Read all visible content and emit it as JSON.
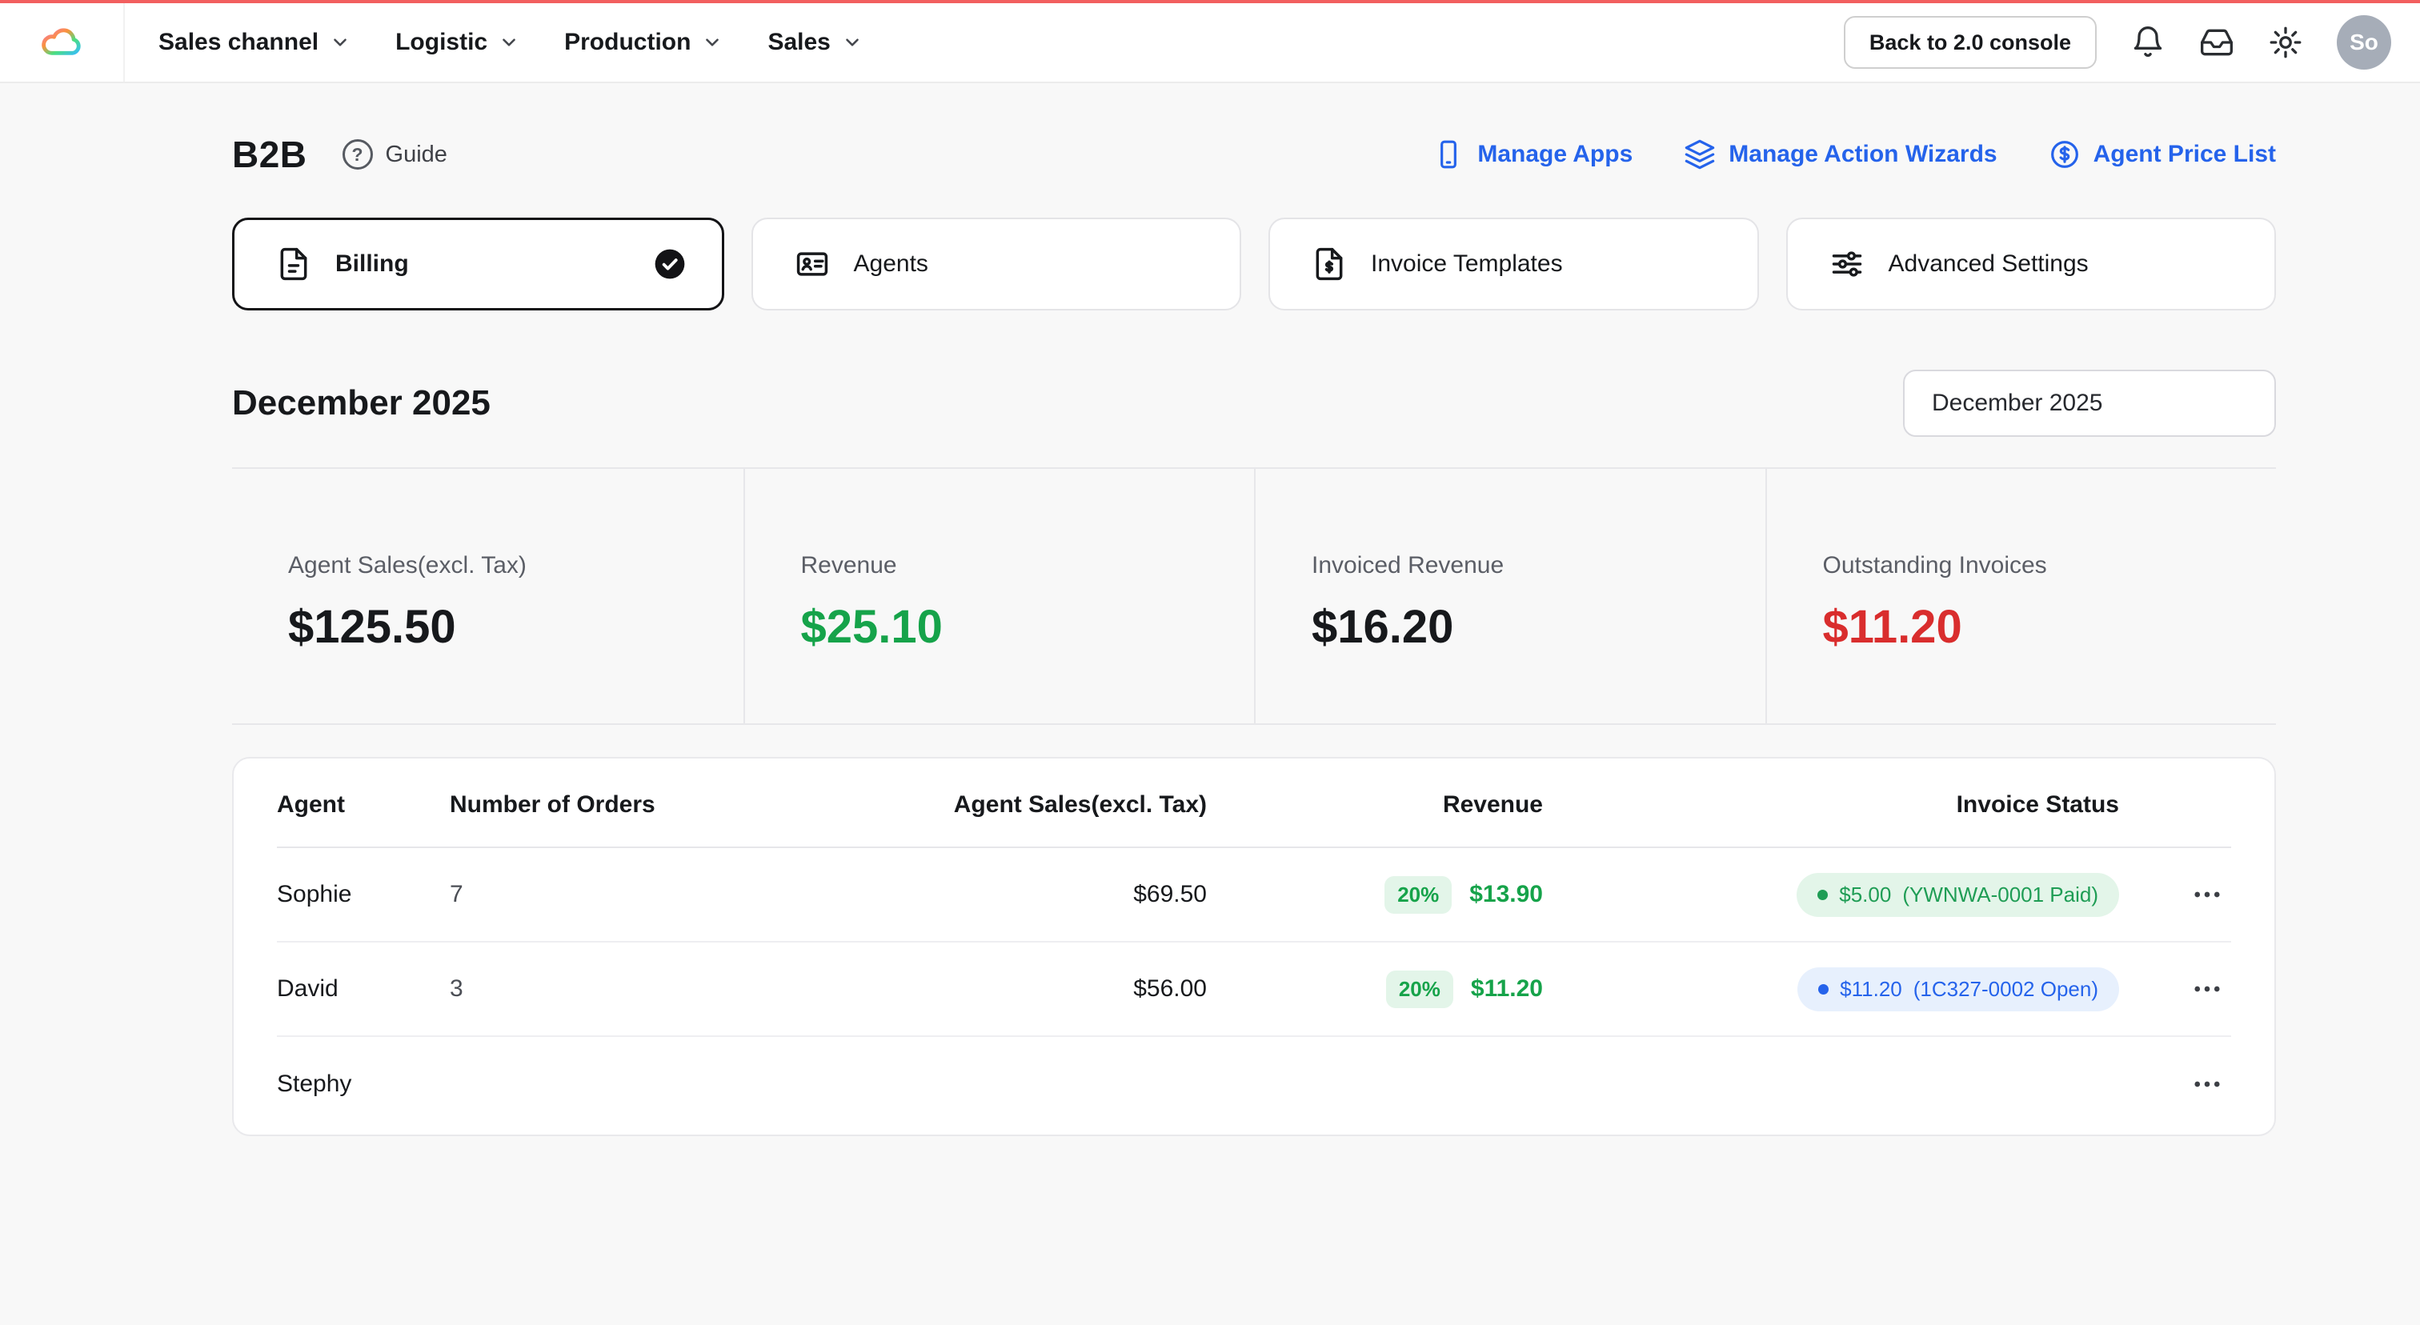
{
  "topbar": {
    "nav": [
      {
        "label": "Sales channel"
      },
      {
        "label": "Logistic"
      },
      {
        "label": "Production"
      },
      {
        "label": "Sales"
      }
    ],
    "back_button": "Back to 2.0 console",
    "avatar_initials": "So"
  },
  "header": {
    "title": "B2B",
    "guide_qmark": "?",
    "guide_label": "Guide",
    "links": [
      {
        "label": "Manage Apps",
        "icon": "phone-icon"
      },
      {
        "label": "Manage Action Wizards",
        "icon": "layers-icon"
      },
      {
        "label": "Agent Price List",
        "icon": "dollar-circle-icon"
      }
    ]
  },
  "tabs": [
    {
      "label": "Billing",
      "active": true,
      "icon": "file-icon"
    },
    {
      "label": "Agents",
      "active": false,
      "icon": "id-card-icon"
    },
    {
      "label": "Invoice Templates",
      "active": false,
      "icon": "file-dollar-icon"
    },
    {
      "label": "Advanced Settings",
      "active": false,
      "icon": "sliders-icon"
    }
  ],
  "period": {
    "heading": "December 2025",
    "selector_value": "December 2025"
  },
  "stats": [
    {
      "label": "Agent Sales(excl. Tax)",
      "value": "$125.50",
      "color": "#17191c"
    },
    {
      "label": "Revenue",
      "value": "$25.10",
      "color": "#16a34a"
    },
    {
      "label": "Invoiced Revenue",
      "value": "$16.20",
      "color": "#17191c"
    },
    {
      "label": "Outstanding Invoices",
      "value": "$11.20",
      "color": "#d92d2d"
    }
  ],
  "table": {
    "headers": {
      "agent": "Agent",
      "orders": "Number of Orders",
      "sales": "Agent Sales(excl. Tax)",
      "revenue": "Revenue",
      "status": "Invoice Status"
    },
    "rows": [
      {
        "agent": "Sophie",
        "orders": "7",
        "sales": "$69.50",
        "revenue_pct": "20%",
        "revenue": "$13.90",
        "status_amount": "$5.00",
        "status_ref": "(YWNWA-0001 Paid)",
        "status_state": "paid"
      },
      {
        "agent": "David",
        "orders": "3",
        "sales": "$56.00",
        "revenue_pct": "20%",
        "revenue": "$11.20",
        "status_amount": "$11.20",
        "status_ref": "(1C327-0002 Open)",
        "status_state": "open"
      },
      {
        "agent": "Stephy"
      }
    ]
  },
  "icons": {
    "logo": "rainbow-cloud",
    "nav_caret": "chevron-down",
    "topbar_right": [
      "bell",
      "inbox-tray",
      "gear"
    ],
    "active_tab_marker": "check-circle",
    "row_actions": "ellipsis"
  },
  "colors": {
    "accent_blue": "#2563eb",
    "green": "#16a34a",
    "red": "#d92d2d",
    "paid_pill_bg": "#e3f5e9",
    "open_pill_bg": "#e7f0fd",
    "top_accent": "#f25f5f"
  }
}
